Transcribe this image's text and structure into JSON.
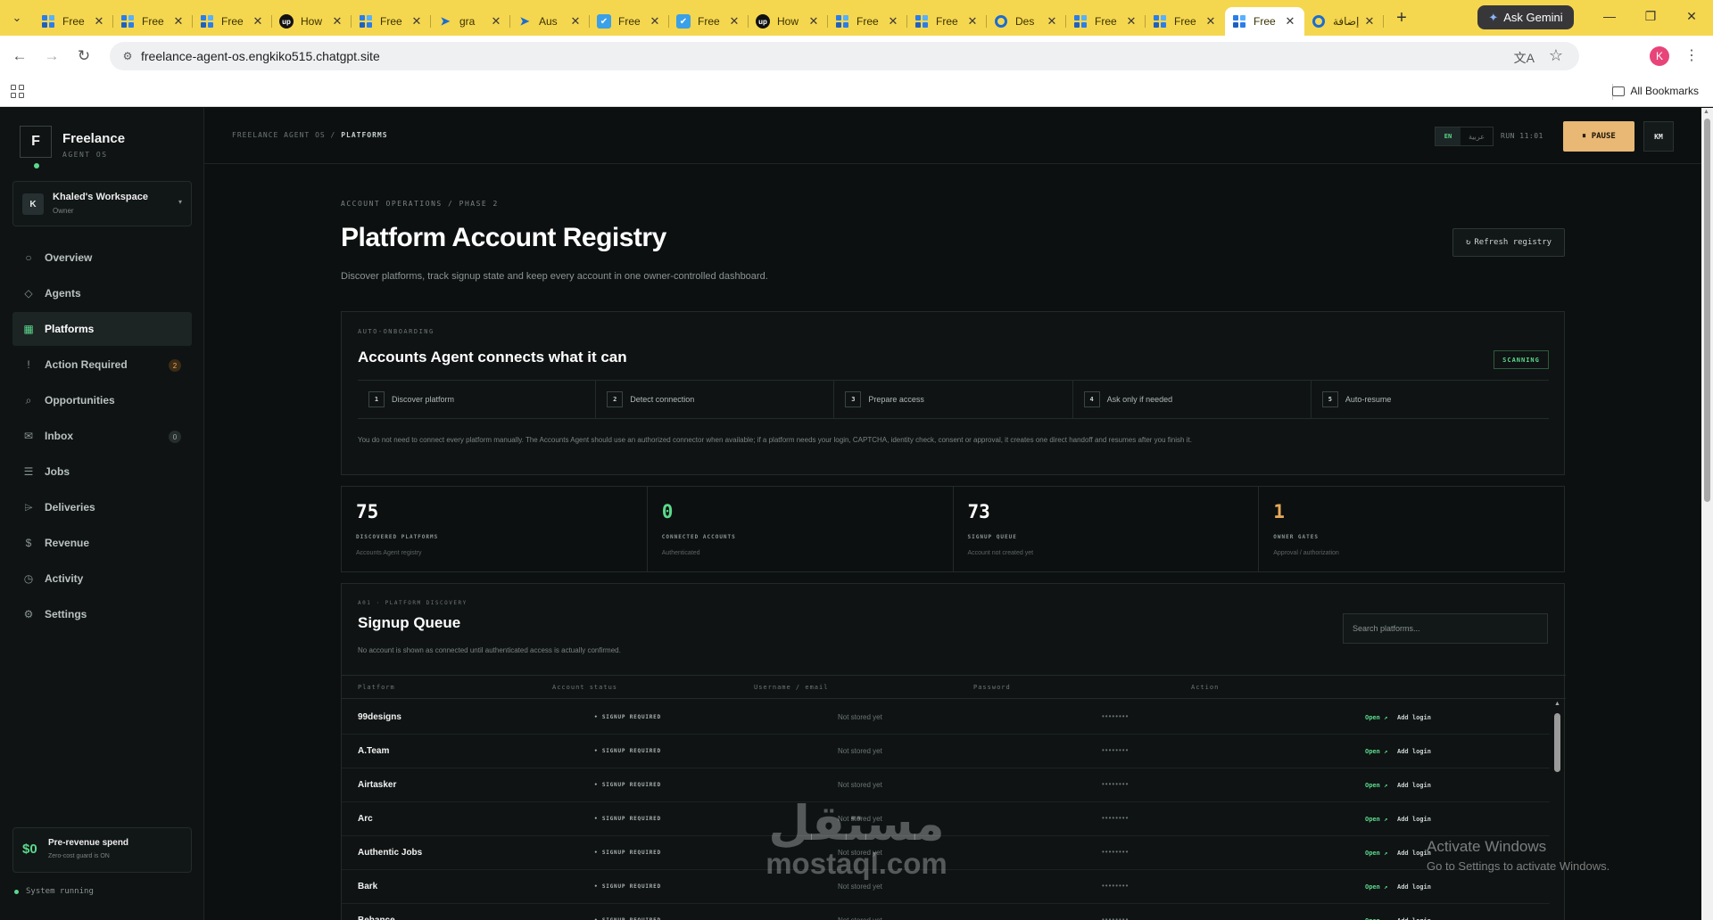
{
  "browser": {
    "tabs": [
      {
        "title": "Free",
        "icon": "grid-favicon",
        "active": false
      },
      {
        "title": "Free",
        "icon": "grid-favicon",
        "active": false
      },
      {
        "title": "Free",
        "icon": "grid-favicon",
        "active": false
      },
      {
        "title": "How",
        "icon": "upwork-favicon",
        "active": false
      },
      {
        "title": "Free",
        "icon": "grid-favicon",
        "active": false
      },
      {
        "title": "gra",
        "icon": "arrow-favicon",
        "active": false
      },
      {
        "title": "Aus",
        "icon": "arrow-favicon",
        "active": false
      },
      {
        "title": "Free",
        "icon": "bird-favicon",
        "active": false
      },
      {
        "title": "Free",
        "icon": "bird-favicon",
        "active": false
      },
      {
        "title": "How",
        "icon": "upwork-favicon",
        "active": false
      },
      {
        "title": "Free",
        "icon": "grid-favicon",
        "active": false
      },
      {
        "title": "Free",
        "icon": "grid-favicon",
        "active": false
      },
      {
        "title": "Des",
        "icon": "circle-favicon",
        "active": false
      },
      {
        "title": "Free",
        "icon": "grid-favicon",
        "active": false
      },
      {
        "title": "Free",
        "icon": "grid-favicon",
        "active": false
      },
      {
        "title": "Free",
        "icon": "grid-favicon",
        "active": true
      },
      {
        "title": "إضافة",
        "icon": "circle-favicon",
        "active": false
      }
    ],
    "gemini_label": "Ask Gemini",
    "url": "freelance-agent-os.engkiko515.chatgpt.site",
    "profile_initial": "K",
    "all_bookmarks": "All Bookmarks"
  },
  "sidebar": {
    "logo_letter": "F",
    "brand_name": "Freelance",
    "brand_sub": "AGENT OS",
    "workspace": {
      "avatar": "K",
      "name": "Khaled's Workspace",
      "role": "Owner"
    },
    "items": [
      {
        "label": "Overview",
        "icon": "circle-icon",
        "glyph": "○",
        "badge": null
      },
      {
        "label": "Agents",
        "icon": "diamond-icon",
        "glyph": "◇",
        "badge": null
      },
      {
        "label": "Platforms",
        "icon": "grid-icon",
        "glyph": "▦",
        "badge": null,
        "active": true
      },
      {
        "label": "Action Required",
        "icon": "alert-icon",
        "glyph": "!",
        "badge": "2"
      },
      {
        "label": "Opportunities",
        "icon": "search-icon",
        "glyph": "⌕",
        "badge": null
      },
      {
        "label": "Inbox",
        "icon": "mail-icon",
        "glyph": "✉",
        "badge": "0"
      },
      {
        "label": "Jobs",
        "icon": "list-icon",
        "glyph": "☰",
        "badge": null
      },
      {
        "label": "Deliveries",
        "icon": "send-icon",
        "glyph": "⌲",
        "badge": null
      },
      {
        "label": "Revenue",
        "icon": "dollar-icon",
        "glyph": "$",
        "badge": null
      },
      {
        "label": "Activity",
        "icon": "clock-icon",
        "glyph": "◷",
        "badge": null
      },
      {
        "label": "Settings",
        "icon": "gear-icon",
        "glyph": "⚙",
        "badge": null
      }
    ],
    "spend": {
      "amount": "$0",
      "title": "Pre-revenue spend",
      "sub": "Zero-cost guard is ON"
    },
    "system_status": "System running"
  },
  "topbar": {
    "crumb_root": "FREELANCE AGENT OS",
    "crumb_sep": "/",
    "crumb_current": "PLATFORMS",
    "lang_en": "EN",
    "lang_ar": "عربية",
    "run": "RUN 11:01",
    "pause_label": "PAUSE",
    "user_initials": "KM"
  },
  "page": {
    "eyebrow": "ACCOUNT OPERATIONS / PHASE 2",
    "title": "Platform Account Registry",
    "description": "Discover platforms, track signup state and keep every account in one owner-controlled dashboard.",
    "refresh_label": "Refresh registry"
  },
  "onboarding": {
    "eyebrow": "AUTO-ONBOARDING",
    "title": "Accounts Agent connects what it can",
    "badge": "SCANNING",
    "steps": [
      {
        "num": "1",
        "label": "Discover platform"
      },
      {
        "num": "2",
        "label": "Detect connection"
      },
      {
        "num": "3",
        "label": "Prepare access"
      },
      {
        "num": "4",
        "label": "Ask only if needed"
      },
      {
        "num": "5",
        "label": "Auto-resume"
      }
    ],
    "note": "You do not need to connect every platform manually. The Accounts Agent should use an authorized connector when available; if a platform needs your login, CAPTCHA, identity check, consent or approval, it creates one direct handoff and resumes after you finish it."
  },
  "stats": [
    {
      "value": "75",
      "key": "DISCOVERED PLATFORMS",
      "sub": "Accounts Agent registry",
      "color": "#ffffff"
    },
    {
      "value": "0",
      "key": "CONNECTED ACCOUNTS",
      "sub": "Authenticated",
      "color": "#5bd98c"
    },
    {
      "value": "73",
      "key": "SIGNUP QUEUE",
      "sub": "Account not created yet",
      "color": "#ffffff"
    },
    {
      "value": "1",
      "key": "OWNER GATES",
      "sub": "Approval / authorization",
      "color": "#e8a95a"
    }
  ],
  "queue": {
    "eyebrow": "A01 · PLATFORM DISCOVERY",
    "title": "Signup Queue",
    "note": "No account is shown as connected until authenticated access is actually confirmed.",
    "search_placeholder": "Search platforms...",
    "columns": [
      "Platform",
      "Account status",
      "Username / email",
      "Password",
      "Action"
    ],
    "rows": [
      {
        "platform": "99designs",
        "status": "• SIGNUP REQUIRED",
        "user": "Not stored yet",
        "password": "••••••••",
        "open": "Open ↗",
        "add": "Add login"
      },
      {
        "platform": "A.Team",
        "status": "• SIGNUP REQUIRED",
        "user": "Not stored yet",
        "password": "••••••••",
        "open": "Open ↗",
        "add": "Add login"
      },
      {
        "platform": "Airtasker",
        "status": "• SIGNUP REQUIRED",
        "user": "Not stored yet",
        "password": "••••••••",
        "open": "Open ↗",
        "add": "Add login"
      },
      {
        "platform": "Arc",
        "status": "• SIGNUP REQUIRED",
        "user": "Not stored yet",
        "password": "••••••••",
        "open": "Open ↗",
        "add": "Add login"
      },
      {
        "platform": "Authentic Jobs",
        "status": "• SIGNUP REQUIRED",
        "user": "Not stored yet",
        "password": "••••••••",
        "open": "Open ↗",
        "add": "Add login"
      },
      {
        "platform": "Bark",
        "status": "• SIGNUP REQUIRED",
        "user": "Not stored yet",
        "password": "••••••••",
        "open": "Open ↗",
        "add": "Add login"
      },
      {
        "platform": "Behance",
        "status": "• SIGNUP REQUIRED",
        "user": "Not stored yet",
        "password": "••••••••",
        "open": "Open ↗",
        "add": "Add login"
      }
    ]
  },
  "overlay": {
    "watermark_ar": "مستقل",
    "watermark_en": "mostaql.com",
    "activate_title": "Activate Windows",
    "activate_sub": "Go to Settings to activate Windows."
  }
}
